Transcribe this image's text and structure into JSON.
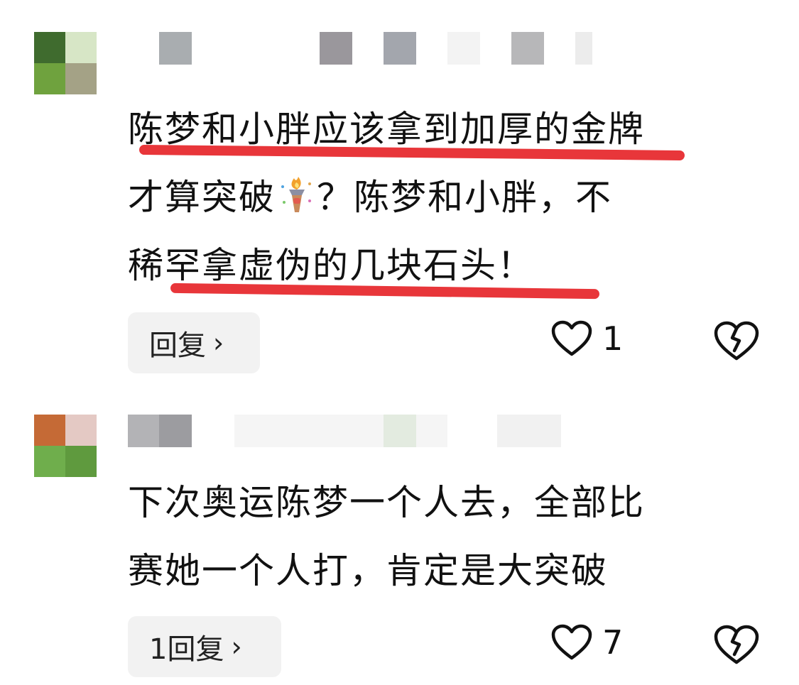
{
  "comments": [
    {
      "text_lines": [
        "陈梦和小胖应该拿到加厚的金牌",
        "才算突破",
        "？陈梦和小胖，不",
        "稀罕拿虚伪的几块石头！"
      ],
      "emoji": "torch-icon",
      "reply_label": "回复",
      "like_count": "1"
    },
    {
      "text_lines": [
        "下次奥运陈梦一个人去，全部比",
        "赛她一个人打，肯定是大突破"
      ],
      "reply_label": "1回复",
      "like_count": "7"
    }
  ],
  "colors": {
    "underline": "#e8363a",
    "reply_bg": "#f2f2f2",
    "text": "#111111"
  }
}
